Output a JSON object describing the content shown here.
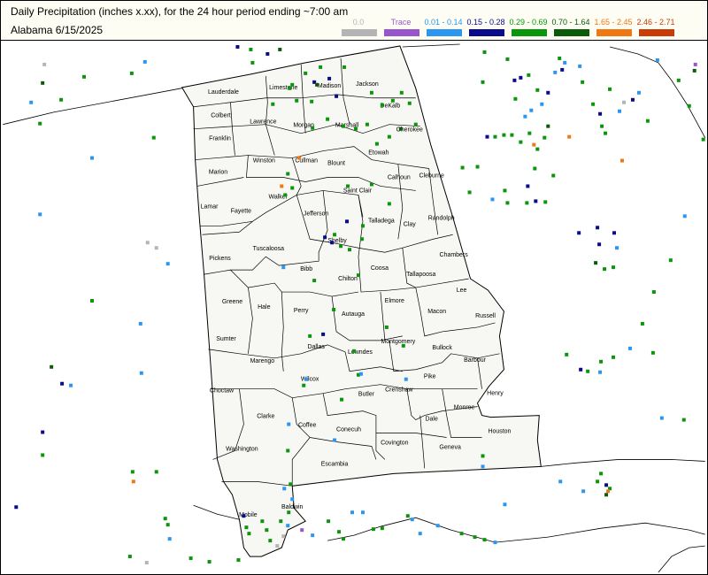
{
  "header": {
    "title": "Daily Precipitation (inches  x.xx),  for the 24 hour period ending ~7:00 am",
    "subtitle": "Alabama 6/15/2025"
  },
  "legend": [
    {
      "label": "0.0",
      "color": "#b4b4b4"
    },
    {
      "label": "Trace",
      "color": "#9955cc"
    },
    {
      "label": "0.01 - 0.14",
      "color": "#2a96f0"
    },
    {
      "label": "0.15 - 0.28",
      "color": "#0a0a8c"
    },
    {
      "label": "0.29 - 0.69",
      "color": "#0a960a"
    },
    {
      "label": "0.70 - 1.64",
      "color": "#0a5a0a"
    },
    {
      "label": "1.65 - 2.45",
      "color": "#f07814"
    },
    {
      "label": "2.46 - 2.71",
      "color": "#c83c0a"
    }
  ],
  "counties": [
    "Lauderdale",
    "Limestone",
    "Madison",
    "Jackson",
    "Colbert",
    "Lawrence",
    "Morgan",
    "Marshall",
    "DeKalb",
    "Franklin",
    "Cherokee",
    "Winston",
    "Cullman",
    "Blount",
    "Etowah",
    "Marion",
    "Calhoun",
    "Cleburne",
    "Saint Clair",
    "Walker",
    "Lamar",
    "Fayette",
    "Jefferson",
    "Randolph",
    "Talladega",
    "Clay",
    "Tuscaloosa",
    "Shelby",
    "Chambers",
    "Pickens",
    "Coosa",
    "Bibb",
    "Tallapoosa",
    "Chilton",
    "Lee",
    "Greene",
    "Hale",
    "Perry",
    "Autauga",
    "Elmore",
    "Macon",
    "Russell",
    "Sumter",
    "Dallas",
    "Montgomery",
    "Lowndes",
    "Bullock",
    "Barbour",
    "Marengo",
    "Wilcox",
    "Pike",
    "Choctaw",
    "Butler",
    "Crenshaw",
    "Henry",
    "Clarke",
    "Coffee",
    "Dale",
    "Monroe",
    "Conecuh",
    "Houston",
    "Washington",
    "Covington",
    "Geneva",
    "Escambia",
    "Mobile",
    "Baldwin"
  ]
}
